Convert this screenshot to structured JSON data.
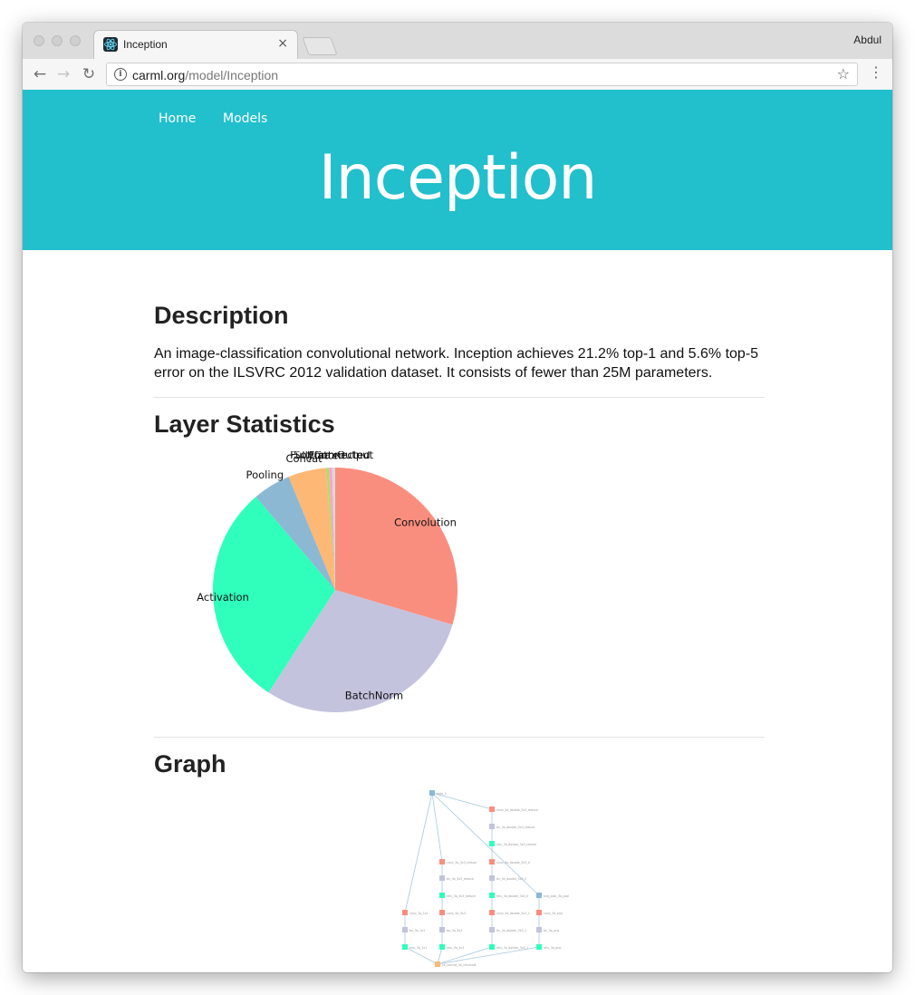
{
  "browser": {
    "tab_title": "Inception",
    "tab_close": "×",
    "profile_name": "Abdul",
    "url_host": "carml.org",
    "url_path": "/model/Inception",
    "back_icon": "←",
    "forward_icon": "→",
    "reload_icon": "↻",
    "star_icon": "☆",
    "menu_icon": "⋮",
    "info_icon": "i"
  },
  "nav": {
    "home": "Home",
    "models": "Models"
  },
  "hero": {
    "title": "Inception",
    "background": "#22bfcc"
  },
  "description": {
    "heading": "Description",
    "text": "An image-classification convolutional network. Inception achieves 21.2% top-1 and 5.6% top-5 error on the ILSVRC 2012 validation dataset. It consists of fewer than 25M parameters."
  },
  "layer_statistics": {
    "heading": "Layer Statistics"
  },
  "chart_data": {
    "type": "pie",
    "labels": [
      "Convolution",
      "BatchNorm",
      "Activation",
      "Pooling",
      "Concat",
      "Flatten",
      "FullyConnected",
      "SoftmaxOutput"
    ],
    "values": [
      29.5,
      29.5,
      29.5,
      5.0,
      5.0,
      0.4,
      0.4,
      0.4
    ],
    "colors": [
      "#fa8e7e",
      "#c4c3de",
      "#2fffbb",
      "#8cb8d4",
      "#fdb875",
      "#b8d96a",
      "#f5a5d0",
      "#d9d9d9"
    ]
  },
  "graph": {
    "heading": "Graph",
    "nodes": [
      "data_0",
      "conv_3a_double_3x3_reduce",
      "bn_3a_double_3x3_reduce",
      "relu_3a_double_3x3_reduce",
      "conv_3a_3x3_reduce",
      "conv_3a_double_3x3_0",
      "bn_3a_3x3_reduce",
      "bn_3a_double_3x3_0",
      "relu_3a_3x3_reduce",
      "relu_3a_double_3x3_0",
      "avg_pool_3a_pool",
      "conv_3a_1x1",
      "conv_3a_3x3",
      "conv_3a_double_3x3_1",
      "conv_3a_proj",
      "bn_3a_1x1",
      "bn_3a_3x3",
      "bn_3a_double_3x3_1",
      "bn_3a_proj",
      "relu_3a_1x1",
      "relu_3a_3x3",
      "relu_3a_double_3x3_1",
      "relu_3a_proj",
      "ch_concat_3a_chconcat"
    ]
  }
}
